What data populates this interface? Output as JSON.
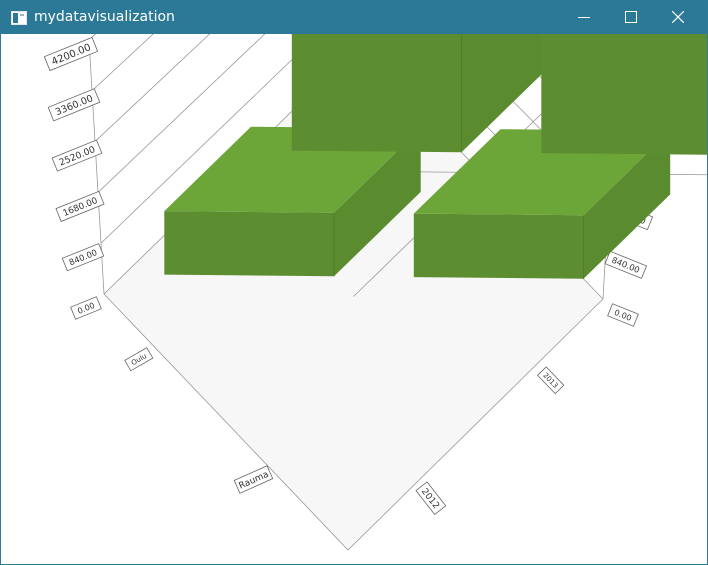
{
  "window": {
    "title": "mydatavisualization",
    "icon": "window-app-icon",
    "controls": [
      "minimize-icon",
      "maximize-icon",
      "close-icon"
    ]
  },
  "colors": {
    "titlebar": "#2b7996",
    "bar_top": "#6da638",
    "bar_left": "#5c8d31",
    "bar_right": "#5a8b2f",
    "floor": "#f7f7f7",
    "shadow": "#a8a8a8"
  },
  "chart_data": {
    "type": "bar",
    "three_d": true,
    "rows": [
      "Oulu",
      "Rauma"
    ],
    "columns": [
      "2012",
      "2013"
    ],
    "bars": [
      {
        "row": "Oulu",
        "column": "2012",
        "value": 4200
      },
      {
        "row": "Oulu",
        "column": "2013",
        "value": 3400
      },
      {
        "row": "Rauma",
        "column": "2012",
        "value": 1050
      },
      {
        "row": "Rauma",
        "column": "2013",
        "value": 1050
      }
    ],
    "y_ticks": [
      "4200.00",
      "3360.00",
      "2520.00",
      "1680.00",
      "840.00",
      "0.00"
    ],
    "ylim": [
      0,
      4200
    ],
    "row_labels": [
      "Oulu",
      "Rauma"
    ],
    "column_labels": [
      "2012",
      "2013"
    ],
    "grid": true,
    "legend": "none"
  }
}
